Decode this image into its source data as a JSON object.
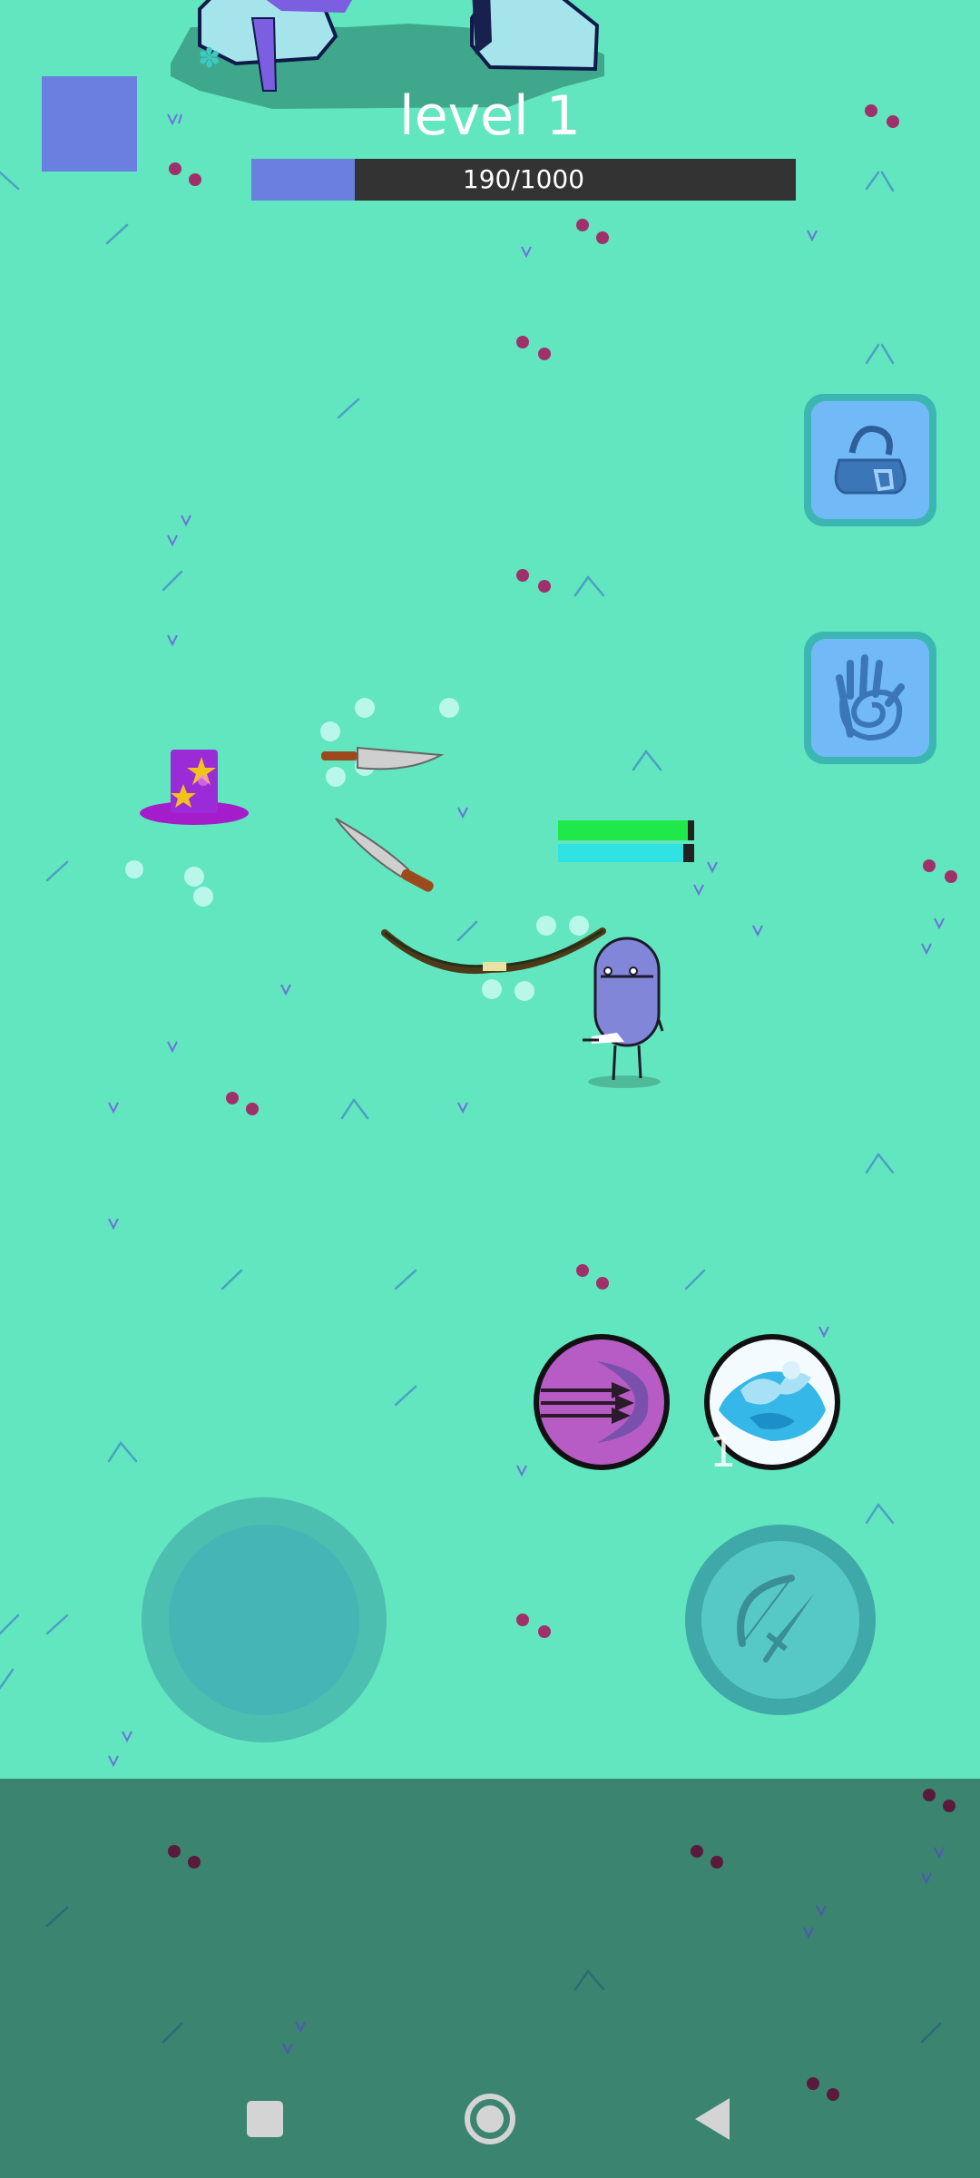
{
  "hud": {
    "level_label": "level 1",
    "xp_text": "190/1000",
    "xp_fraction": 0.19
  },
  "colors": {
    "field": "#62e6bf",
    "ground_dark": "#3a8470",
    "xp_fill": "#6a7fe0",
    "health": "#1ee84a",
    "mana": "#2fe3e3"
  },
  "player": {
    "health_fraction": 0.95,
    "mana_fraction": 0.92
  },
  "skills": {
    "water_charges": "1"
  },
  "buttons": {
    "inventory_icon": "bag-icon",
    "spell_icon": "spiral-hand-icon",
    "dash_icon": "triple-arrow-icon",
    "water_icon": "water-splash-icon",
    "attack_icon": "bow-sword-icon"
  },
  "navigation": {
    "recents_icon": "square-icon",
    "home_icon": "circle-icon",
    "back_icon": "triangle-back-icon"
  }
}
